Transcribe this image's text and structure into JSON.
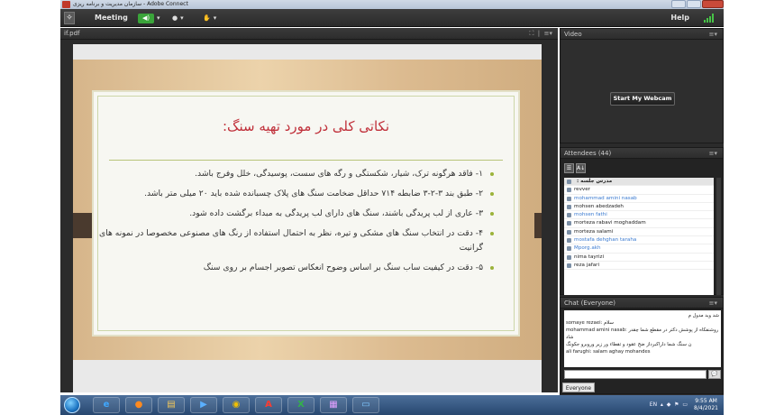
{
  "window": {
    "title": "سازمان مدیریت و برنامه ریزی - Adobe Connect"
  },
  "menubar": {
    "meeting": "Meeting",
    "help": "Help",
    "audio_icon": "speaker-icon",
    "camera_icon": "user-icon",
    "hand_icon": "raise-hand-icon"
  },
  "share": {
    "title": "if.pdf",
    "slide_title": "نکاتی کلی در مورد تهیه سنگ:",
    "bullets": [
      "۱- فاقد هرگونه ترک، شیار، شکستگی و رگه های سست، پوسیدگی، خلل وفرج باشد.",
      "۲- طبق بند ۳-۲-۳ ضابطه ۷۱۴ حداقل ضخامت سنگ های پلاک چسبانده شده باید ۲۰ میلی متر باشد.",
      "۳- عاری از لب پریدگی باشند، سنگ های دارای لب پریدگی به مبداء برگشت داده شود.",
      "۴- دقت در انتخاب سنگ های مشکی و تیره، نظر به احتمال استفاده از رنگ های مصنوعی مخصوصا در نمونه های گرانیت",
      "۵- دقت در کیفیت ساب سنگ بر اساس وضوح انعکاس تصویر اجسام بر روی سنگ"
    ]
  },
  "video": {
    "title": "Video",
    "webcam_button": "Start My Webcam"
  },
  "attendees": {
    "title": "Attendees (44)",
    "header": "مدرس جلسه :",
    "list": [
      {
        "name": "revver",
        "blue": false
      },
      {
        "name": "mohammad amini nasab",
        "blue": true
      },
      {
        "name": "mohsen abedzadeh",
        "blue": false
      },
      {
        "name": "mohsen fathi",
        "blue": true
      },
      {
        "name": "morteza rabavi moghaddam",
        "blue": false
      },
      {
        "name": "morteza salami",
        "blue": false
      },
      {
        "name": "mostafa dehghan taraha",
        "blue": true
      },
      {
        "name": "Mporg.akh",
        "blue": true
      },
      {
        "name": "nima tayrizi",
        "blue": false
      },
      {
        "name": "reza jafari",
        "blue": false
      }
    ]
  },
  "chat": {
    "title": "Chat",
    "audience": "(Everyone)",
    "messages": [
      {
        "text": "شد وید مدول م",
        "ltr": false
      },
      {
        "text": "somaye rezaei: سلام",
        "ltr": true
      },
      {
        "text": "mohammad amini nasab: روشنفکاه از پوشش دکتر در مقطع شما چقدر شاد",
        "ltr": true
      },
      {
        "text": "ن سنگ شما داراکبرداز ضخ عقود و تقطاء ور زیر وروبرو جکونگ",
        "ltr": true
      },
      {
        "text": "ali farughi: salam aghay mohandes",
        "ltr": true
      }
    ],
    "tab": "Everyone"
  },
  "taskbar": {
    "lang": "EN",
    "time": "9:55 AM",
    "date": "8/4/2021"
  },
  "colors": {
    "accent_red": "#c0303a",
    "bullet_green": "#9bb33a",
    "speaker_green": "#3aa43a"
  }
}
